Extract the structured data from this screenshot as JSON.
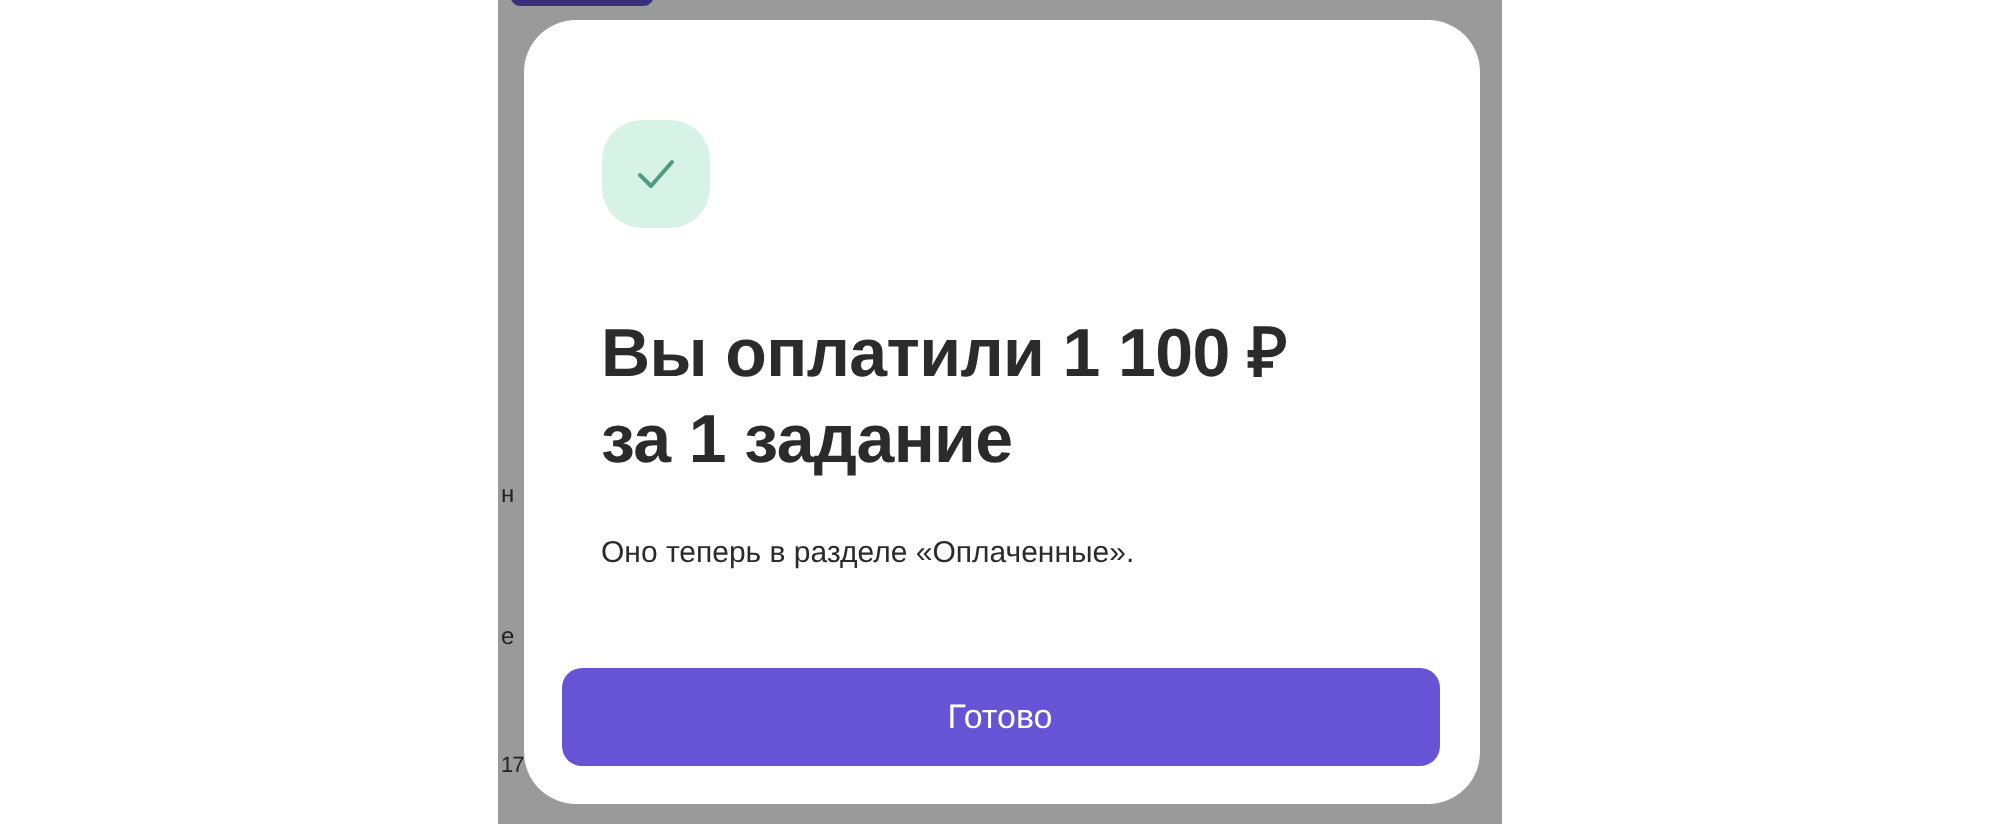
{
  "background": {
    "fragments": [
      "н",
      "е",
      "17"
    ]
  },
  "dialog": {
    "title": "Вы оплатили 1 100 ₽ за 1 задание",
    "message": "Оно теперь в разделе «Оплаченные».",
    "button": "Готово"
  }
}
